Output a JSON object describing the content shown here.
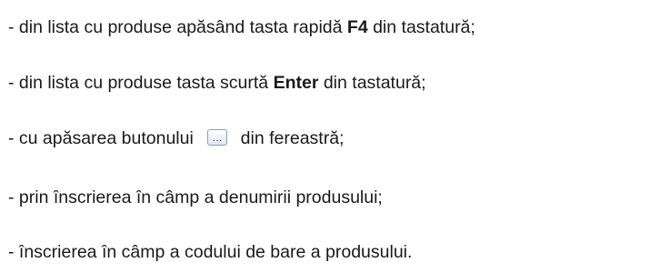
{
  "lines": [
    {
      "pre": "- din lista cu produse apăsând tasta rapidă ",
      "bold": "F4",
      "post": " din tastatură;"
    },
    {
      "pre": "- din lista cu produse tasta scurtă ",
      "bold": "Enter",
      "post": " din tastatură;"
    },
    {
      "pre": "- cu apăsarea butonului ",
      "button_label": "...",
      "post": " din fereastră;"
    },
    {
      "text": "- prin înscrierea în câmp a denumirii produsului;"
    },
    {
      "text": "- înscrierea în câmp a codului de bare a produsului."
    }
  ],
  "icons": {
    "button": "ellipsis-button-icon"
  }
}
